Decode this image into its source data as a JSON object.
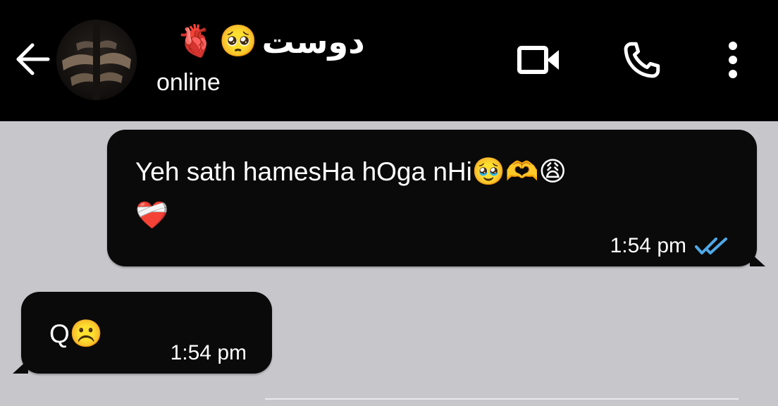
{
  "header": {
    "back_label": "←",
    "contact_name": "دوست",
    "name_emojis": [
      "🫀",
      "🥺"
    ],
    "status": "online",
    "background": "#000000"
  },
  "icons": {
    "back": "arrow-left-icon",
    "avatar": "profile-photo",
    "video": "video-camera-icon",
    "call": "phone-icon",
    "menu": "more-vertical-icon",
    "read_receipt": "double-check-icon"
  },
  "messages": [
    {
      "direction": "outgoing",
      "line1_text": "Yeh sath hamesHa hOga nHi",
      "line1_emojis": "🥹🫶😩",
      "line2_emojis": "❤️‍🩹",
      "time": "1:54 pm",
      "read": true
    },
    {
      "direction": "incoming",
      "text": "Q",
      "emojis": "☹️",
      "time": "1:54 pm"
    }
  ],
  "colors": {
    "chat_background": "#c7c6cb",
    "bubble": "#0a0a0a",
    "read_tick": "#4fa9e8",
    "text": "#ffffff"
  }
}
